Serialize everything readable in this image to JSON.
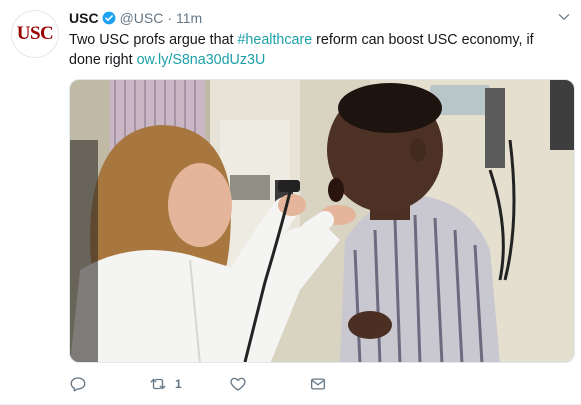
{
  "avatar": {
    "logo_text": "USC",
    "brand_color": "#990000"
  },
  "header": {
    "name": "USC",
    "handle": "@USC",
    "separator": "·",
    "time": "11m"
  },
  "tweet": {
    "text_before": "Two USC profs argue that ",
    "hashtag": "#healthcare",
    "text_after": " reform can boost USC economy, if done right ",
    "link": "ow.ly/S8na30dUz3U",
    "link_color": "#1da1a8"
  },
  "media": {
    "description_icon": "photo-doctor-examining-patient"
  },
  "actions": {
    "reply_icon": "reply-icon",
    "retweet_icon": "retweet-icon",
    "retweet_count": "1",
    "like_icon": "heart-icon",
    "dm_icon": "envelope-icon"
  }
}
